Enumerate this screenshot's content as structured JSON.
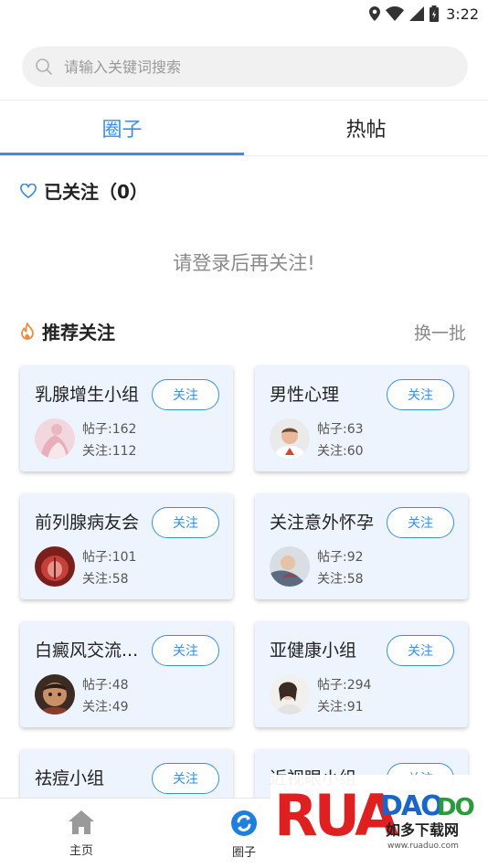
{
  "status_bar": {
    "time": "3:22"
  },
  "search": {
    "placeholder": "请输入关键词搜索"
  },
  "tabs": [
    {
      "label": "圈子",
      "active": true
    },
    {
      "label": "热帖",
      "active": false
    }
  ],
  "followed": {
    "title": "已关注（0）",
    "login_hint": "请登录后再关注!"
  },
  "recommend": {
    "title": "推荐关注",
    "refresh_label": "换一批",
    "follow_label": "关注",
    "posts_prefix": "帖子:",
    "follows_prefix": "关注:",
    "groups": [
      {
        "name": "乳腺增生小组",
        "posts": "162",
        "follows": "112"
      },
      {
        "name": "男性心理",
        "posts": "63",
        "follows": "60"
      },
      {
        "name": "前列腺病友会",
        "posts": "101",
        "follows": "58"
      },
      {
        "name": "关注意外怀孕",
        "posts": "92",
        "follows": "58"
      },
      {
        "name": "白癜风交流...",
        "posts": "48",
        "follows": "49"
      },
      {
        "name": "亚健康小组",
        "posts": "294",
        "follows": "91"
      },
      {
        "name": "祛痘小组",
        "posts": "",
        "follows": ""
      },
      {
        "name": "近视眼小组",
        "posts": "",
        "follows": ""
      }
    ]
  },
  "bottom_nav": [
    {
      "label": "主页",
      "icon": "home-icon"
    },
    {
      "label": "圈子",
      "icon": "circle-icon"
    }
  ],
  "watermark": {
    "brand": "RUANDUO",
    "sub": "如多下载网",
    "url": "www.ruaduo.com"
  },
  "colors": {
    "accent": "#3a8ee6",
    "card_bg": "#eef4fd",
    "fire": "#f08a3c"
  }
}
